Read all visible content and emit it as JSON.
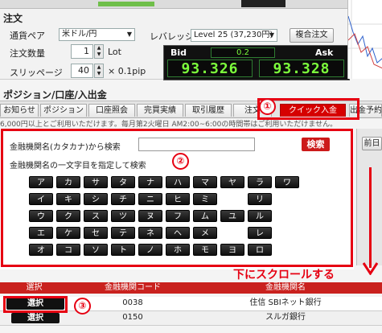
{
  "top_strip": {
    "trailing": "..."
  },
  "order": {
    "title": "注文",
    "pair_label": "通貨ペア",
    "pair_value": "米ドル/円",
    "qty_label": "注文数量",
    "qty_value": "1",
    "qty_unit": "Lot",
    "slippage_label": "スリッページ",
    "slippage_value": "40",
    "slippage_unit": "× 0.1pip",
    "leverage_label": "レバレッジ",
    "leverage_value": "Level 25 (37,230円)",
    "compound_button": "複合注文",
    "bid_label": "Bid",
    "ask_label": "Ask",
    "spread": "0.2",
    "bid": "93.326",
    "ask": "93.328"
  },
  "position_header": "ポジション/口座/入出金",
  "tabs": [
    {
      "label": "お知らせ"
    },
    {
      "label": "ポジション"
    },
    {
      "label": "口座照会"
    },
    {
      "label": "完買実績"
    },
    {
      "label": "取引履歴"
    },
    {
      "label": "注文"
    },
    {
      "label": "クイック入金"
    },
    {
      "label": "出金予約"
    }
  ],
  "notice": "6,000円以上とご利用いただけます。毎月第2火曜日 AM2:00~6:00の時間帯はご利用いただけません。",
  "side_button": "前日",
  "search": {
    "label": "金融機関名(カタカナ)から検索",
    "input_value": "",
    "button": "検索",
    "initial_label": "金融機関名の一文字目を指定して検索"
  },
  "kana_rows": [
    [
      "ア",
      "カ",
      "サ",
      "タ",
      "ナ",
      "ハ",
      "マ",
      "ヤ",
      "ラ",
      "ワ"
    ],
    [
      "イ",
      "キ",
      "シ",
      "チ",
      "ニ",
      "ヒ",
      "ミ",
      "",
      "リ",
      ""
    ],
    [
      "ウ",
      "ク",
      "ス",
      "ツ",
      "ヌ",
      "フ",
      "ム",
      "ユ",
      "ル",
      ""
    ],
    [
      "エ",
      "ケ",
      "セ",
      "テ",
      "ネ",
      "ヘ",
      "メ",
      "",
      "レ",
      ""
    ],
    [
      "オ",
      "コ",
      "ソ",
      "ト",
      "ノ",
      "ホ",
      "モ",
      "ヨ",
      "ロ",
      ""
    ]
  ],
  "annotations": {
    "one": "①",
    "two": "②",
    "three": "③",
    "scroll_text": "下にスクロールする"
  },
  "table": {
    "headers": [
      "選択",
      "金融機関コード",
      "金融機関名"
    ],
    "rows": [
      {
        "select": "選択",
        "code": "0038",
        "name": "住信 SBIネット銀行"
      },
      {
        "select": "選択",
        "code": "0150",
        "name": "スルガ銀行"
      }
    ]
  },
  "colors": {
    "accent_red": "#e60012",
    "quote_green": "#7cff3c"
  }
}
